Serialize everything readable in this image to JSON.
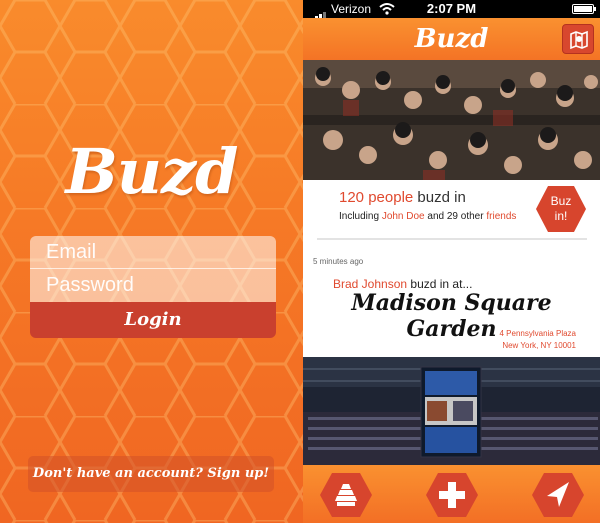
{
  "login": {
    "logo": "Buzd",
    "email_placeholder": "Email",
    "password_placeholder": "Password",
    "login_button": "Login",
    "signup_link": "Don't have an account? Sign up!"
  },
  "status_bar": {
    "carrier": "Verizon",
    "time": "2:07 PM"
  },
  "feed": {
    "title": "Buzd",
    "buzz": {
      "count": "120",
      "count_suffix": "people",
      "buzd_in": "buzd in",
      "including_prefix": "Including",
      "friend_name": "John Doe",
      "and_more": "and 29 other",
      "friends_label": "friends",
      "button_line1": "Buz",
      "button_line2": "in!"
    },
    "checkin": {
      "time_ago": "5 minutes ago",
      "user": "Brad Johnson",
      "action": "buzd in at...",
      "venue": "Madison Square Garden",
      "address_line1": "4 Pennsylvania Plaza",
      "address_line2": "New York, NY 10001"
    }
  },
  "colors": {
    "accent_orange": "#f47325",
    "accent_red": "#e04a2f",
    "button_red": "#c9402e"
  },
  "icons": {
    "map": "map-icon",
    "beehive": "beehive-icon",
    "plus": "plus-icon",
    "location": "location-arrow-icon"
  }
}
